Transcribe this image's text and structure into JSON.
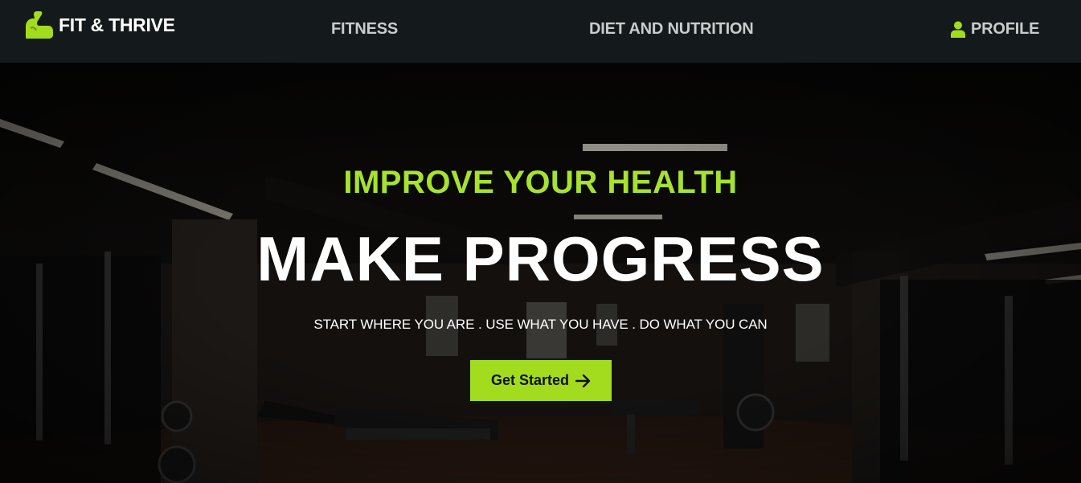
{
  "nav": {
    "brand": "FIT & THRIVE",
    "links": [
      "FITNESS",
      "DIET AND NUTRITION"
    ],
    "profile_label": "PROFILE"
  },
  "hero": {
    "eyebrow": "IMPROVE YOUR HEALTH",
    "title": "MAKE PROGRESS",
    "tagline": "START WHERE YOU ARE . USE WHAT YOU HAVE . DO WHAT YOU CAN",
    "cta_label": "Get Started"
  },
  "colors": {
    "accent": "#a3dc1f",
    "nav_bg": "#141a1b",
    "nav_text": "#c9cccc"
  },
  "icons": {
    "brand": "flexed-arm-icon",
    "profile": "user-icon",
    "cta": "arrow-right-icon"
  }
}
